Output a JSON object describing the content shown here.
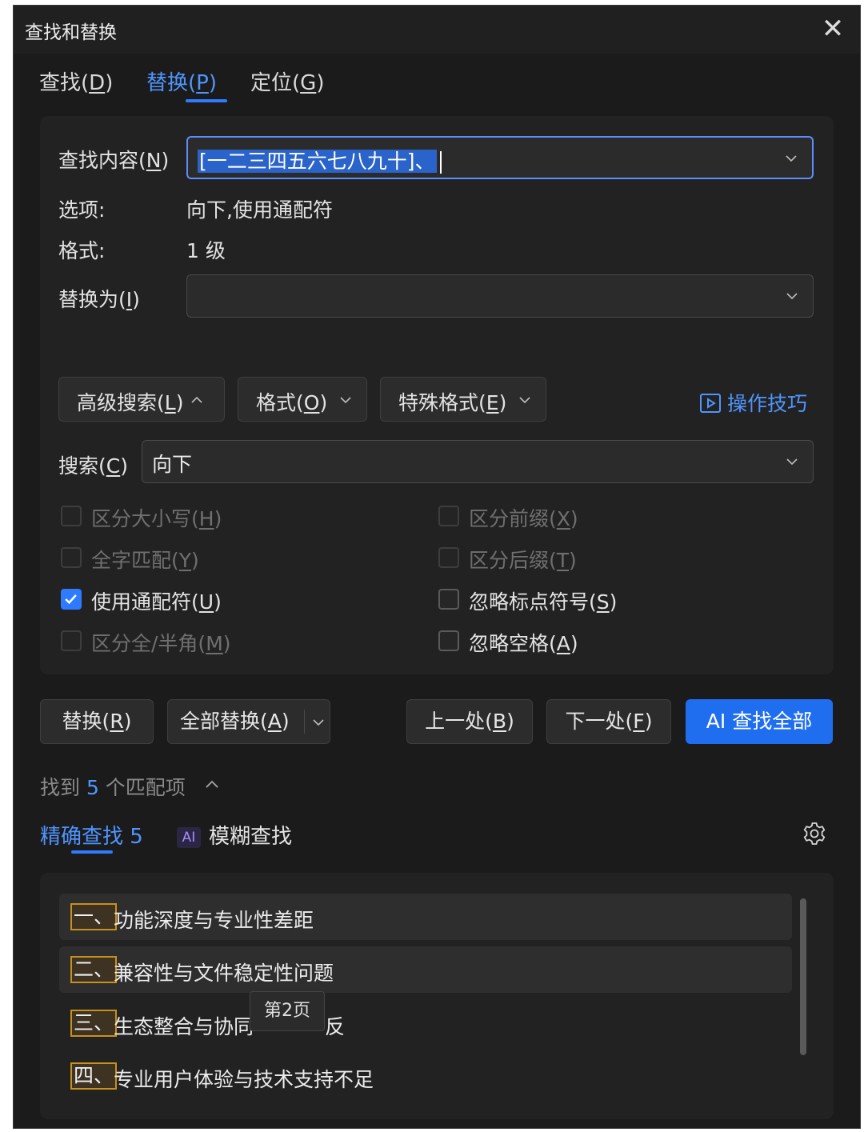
{
  "window": {
    "title": "查找和替换"
  },
  "tabs": [
    {
      "label": "查找(",
      "key": "D",
      "end": ")"
    },
    {
      "label": "替换(",
      "key": "P",
      "end": ")"
    },
    {
      "label": "定位(",
      "key": "G",
      "end": ")"
    }
  ],
  "find": {
    "label": "查找内容(",
    "key": "N",
    "end": ")",
    "value": "[一二三四五六七八九十]、"
  },
  "options": {
    "label": "选项:",
    "value": "向下,使用通配符"
  },
  "format": {
    "label": "格式:",
    "value": "1 级"
  },
  "replace": {
    "label": "替换为(",
    "key": "I",
    "end": ")",
    "value": ""
  },
  "toolbar": {
    "advanced": {
      "label": "高级搜索(",
      "key": "L",
      "end": ")"
    },
    "format": {
      "label": "格式(",
      "key": "O",
      "end": ")"
    },
    "special": {
      "label": "特殊格式(",
      "key": "E",
      "end": ")"
    },
    "tips": "操作技巧"
  },
  "search": {
    "label": "搜索(",
    "key": "C",
    "end": ")",
    "value": "向下"
  },
  "checkboxes": [
    {
      "label": "区分大小写(",
      "key": "H",
      "end": ")",
      "checked": false,
      "disabled": true
    },
    {
      "label": "区分前缀(",
      "key": "X",
      "end": ")",
      "checked": false,
      "disabled": true
    },
    {
      "label": "全字匹配(",
      "key": "Y",
      "end": ")",
      "checked": false,
      "disabled": true
    },
    {
      "label": "区分后缀(",
      "key": "T",
      "end": ")",
      "checked": false,
      "disabled": true
    },
    {
      "label": "使用通配符(",
      "key": "U",
      "end": ")",
      "checked": true,
      "disabled": false
    },
    {
      "label": "忽略标点符号(",
      "key": "S",
      "end": ")",
      "checked": false,
      "disabled": false
    },
    {
      "label": "区分全/半角(",
      "key": "M",
      "end": ")",
      "checked": false,
      "disabled": true
    },
    {
      "label": "忽略空格(",
      "key": "A",
      "end": ")",
      "checked": false,
      "disabled": false
    }
  ],
  "actions": {
    "replace": {
      "label": "替换(",
      "key": "R",
      "end": ")"
    },
    "replace_all": {
      "label": "全部替换(",
      "key": "A",
      "end": ")"
    },
    "prev": {
      "label": "上一处(",
      "key": "B",
      "end": ")"
    },
    "next": {
      "label": "下一处(",
      "key": "F",
      "end": ")"
    },
    "ai_find_all": "AI 查找全部"
  },
  "summary": {
    "pre": "找到 ",
    "count": "5",
    "post": " 个匹配项"
  },
  "match_tabs": {
    "exact": {
      "label": "精确查找",
      "count": "5"
    },
    "fuzzy": {
      "badge": "AI",
      "label": "模糊查找"
    }
  },
  "results": [
    {
      "match": "一、",
      "text": "功能深度与专业性差距"
    },
    {
      "match": "二、",
      "text": "兼容性与文件稳定性问题"
    },
    {
      "match": "三、",
      "text": "生态整合与协同",
      "tail": "反"
    },
    {
      "match": "四、",
      "text": "专业用户体验与技术支持不足"
    }
  ],
  "tooltip": "第2页",
  "colors": {
    "accent": "#2f7bff",
    "match_border": "#c8901d",
    "background": "#1b1b1b"
  }
}
